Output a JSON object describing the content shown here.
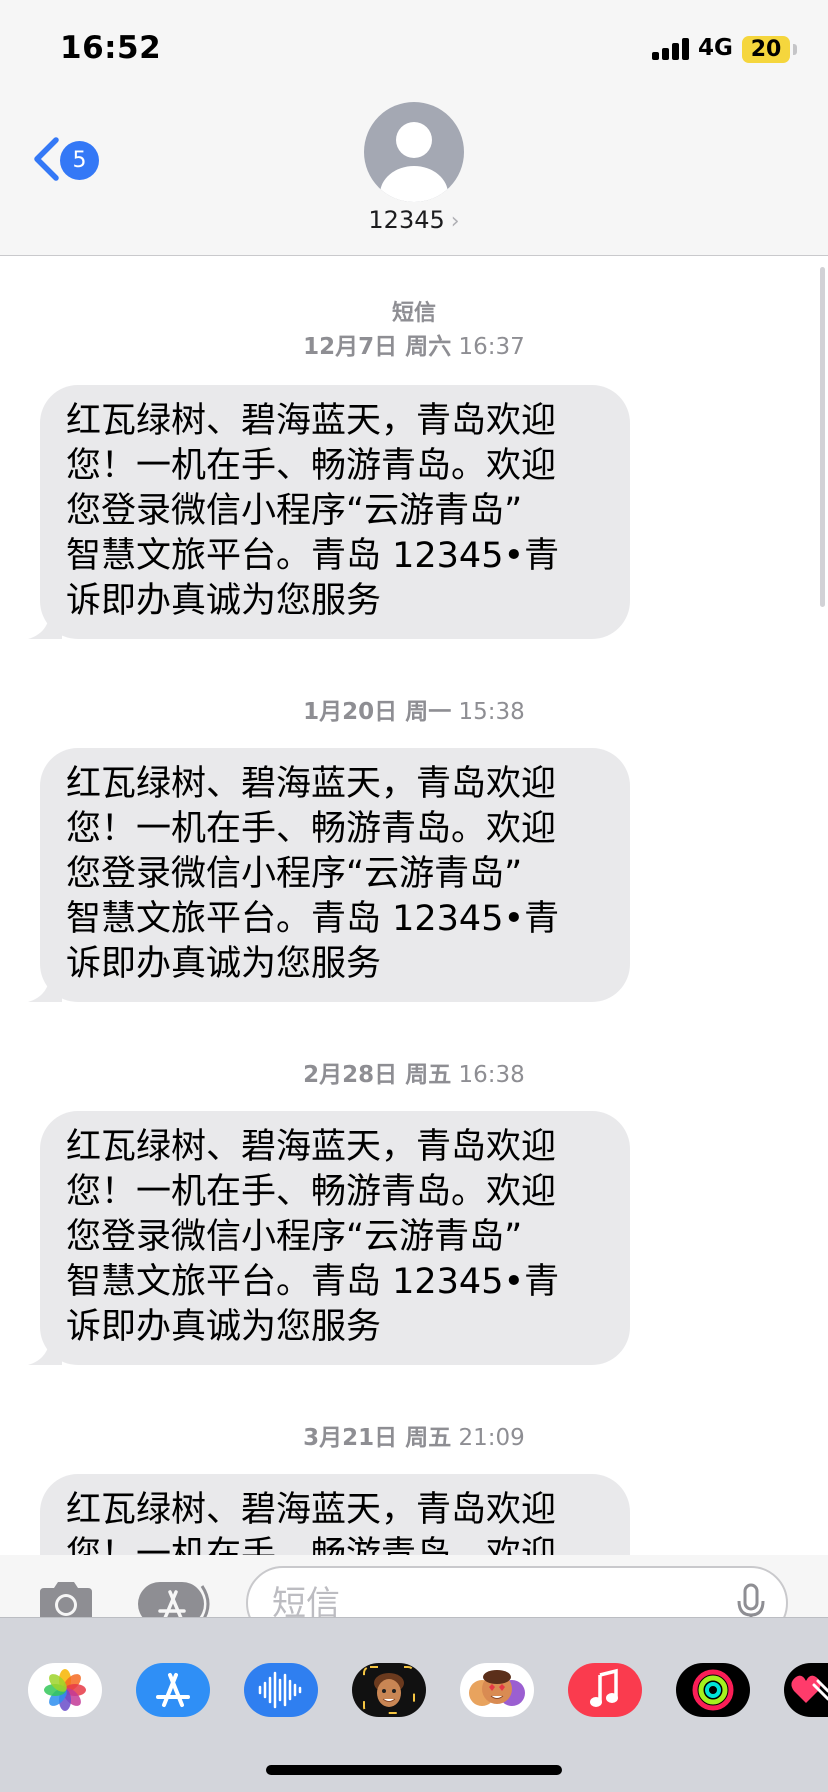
{
  "status_bar": {
    "time": "16:52",
    "network": "4G",
    "battery": "20"
  },
  "nav": {
    "back_badge": "5",
    "contact_name": "12345",
    "contact_chevron": "›"
  },
  "conversation": {
    "service_label": "短信",
    "messages": [
      {
        "timestamp_day": "12月7日 周六",
        "timestamp_time": "16:37",
        "lines": [
          "红瓦绿树、碧海蓝天，青岛欢迎",
          "您！一机在手、畅游青岛。欢迎",
          "您登录微信小程序“云游青岛”",
          "智慧文旅平台。青岛 12345•青",
          "诉即办真诚为您服务"
        ]
      },
      {
        "timestamp_day": "1月20日 周一",
        "timestamp_time": "15:38",
        "lines": [
          "红瓦绿树、碧海蓝天，青岛欢迎",
          "您！一机在手、畅游青岛。欢迎",
          "您登录微信小程序“云游青岛”",
          "智慧文旅平台。青岛 12345•青",
          "诉即办真诚为您服务"
        ]
      },
      {
        "timestamp_day": "2月28日 周五",
        "timestamp_time": "16:38",
        "lines": [
          "红瓦绿树、碧海蓝天，青岛欢迎",
          "您！一机在手、畅游青岛。欢迎",
          "您登录微信小程序“云游青岛”",
          "智慧文旅平台。青岛 12345•青",
          "诉即办真诚为您服务"
        ]
      },
      {
        "timestamp_day": "3月21日 周五",
        "timestamp_time": "21:09",
        "lines": [
          "红瓦绿树、碧海蓝天，青岛欢迎",
          "您！一机在手、畅游青岛。欢迎"
        ]
      }
    ]
  },
  "input_bar": {
    "placeholder": "短信"
  },
  "app_drawer": {
    "apps": [
      "photos-icon",
      "app-store-icon",
      "audio-message-icon",
      "memoji-icon",
      "memoji-stickers-icon",
      "music-icon",
      "activity-icon",
      "digital-touch-icon"
    ]
  },
  "colors": {
    "accent": "#3478f6",
    "bubble": "#e9e9eb",
    "battery": "#f5d63d",
    "secondary_text": "#8e8e93"
  }
}
